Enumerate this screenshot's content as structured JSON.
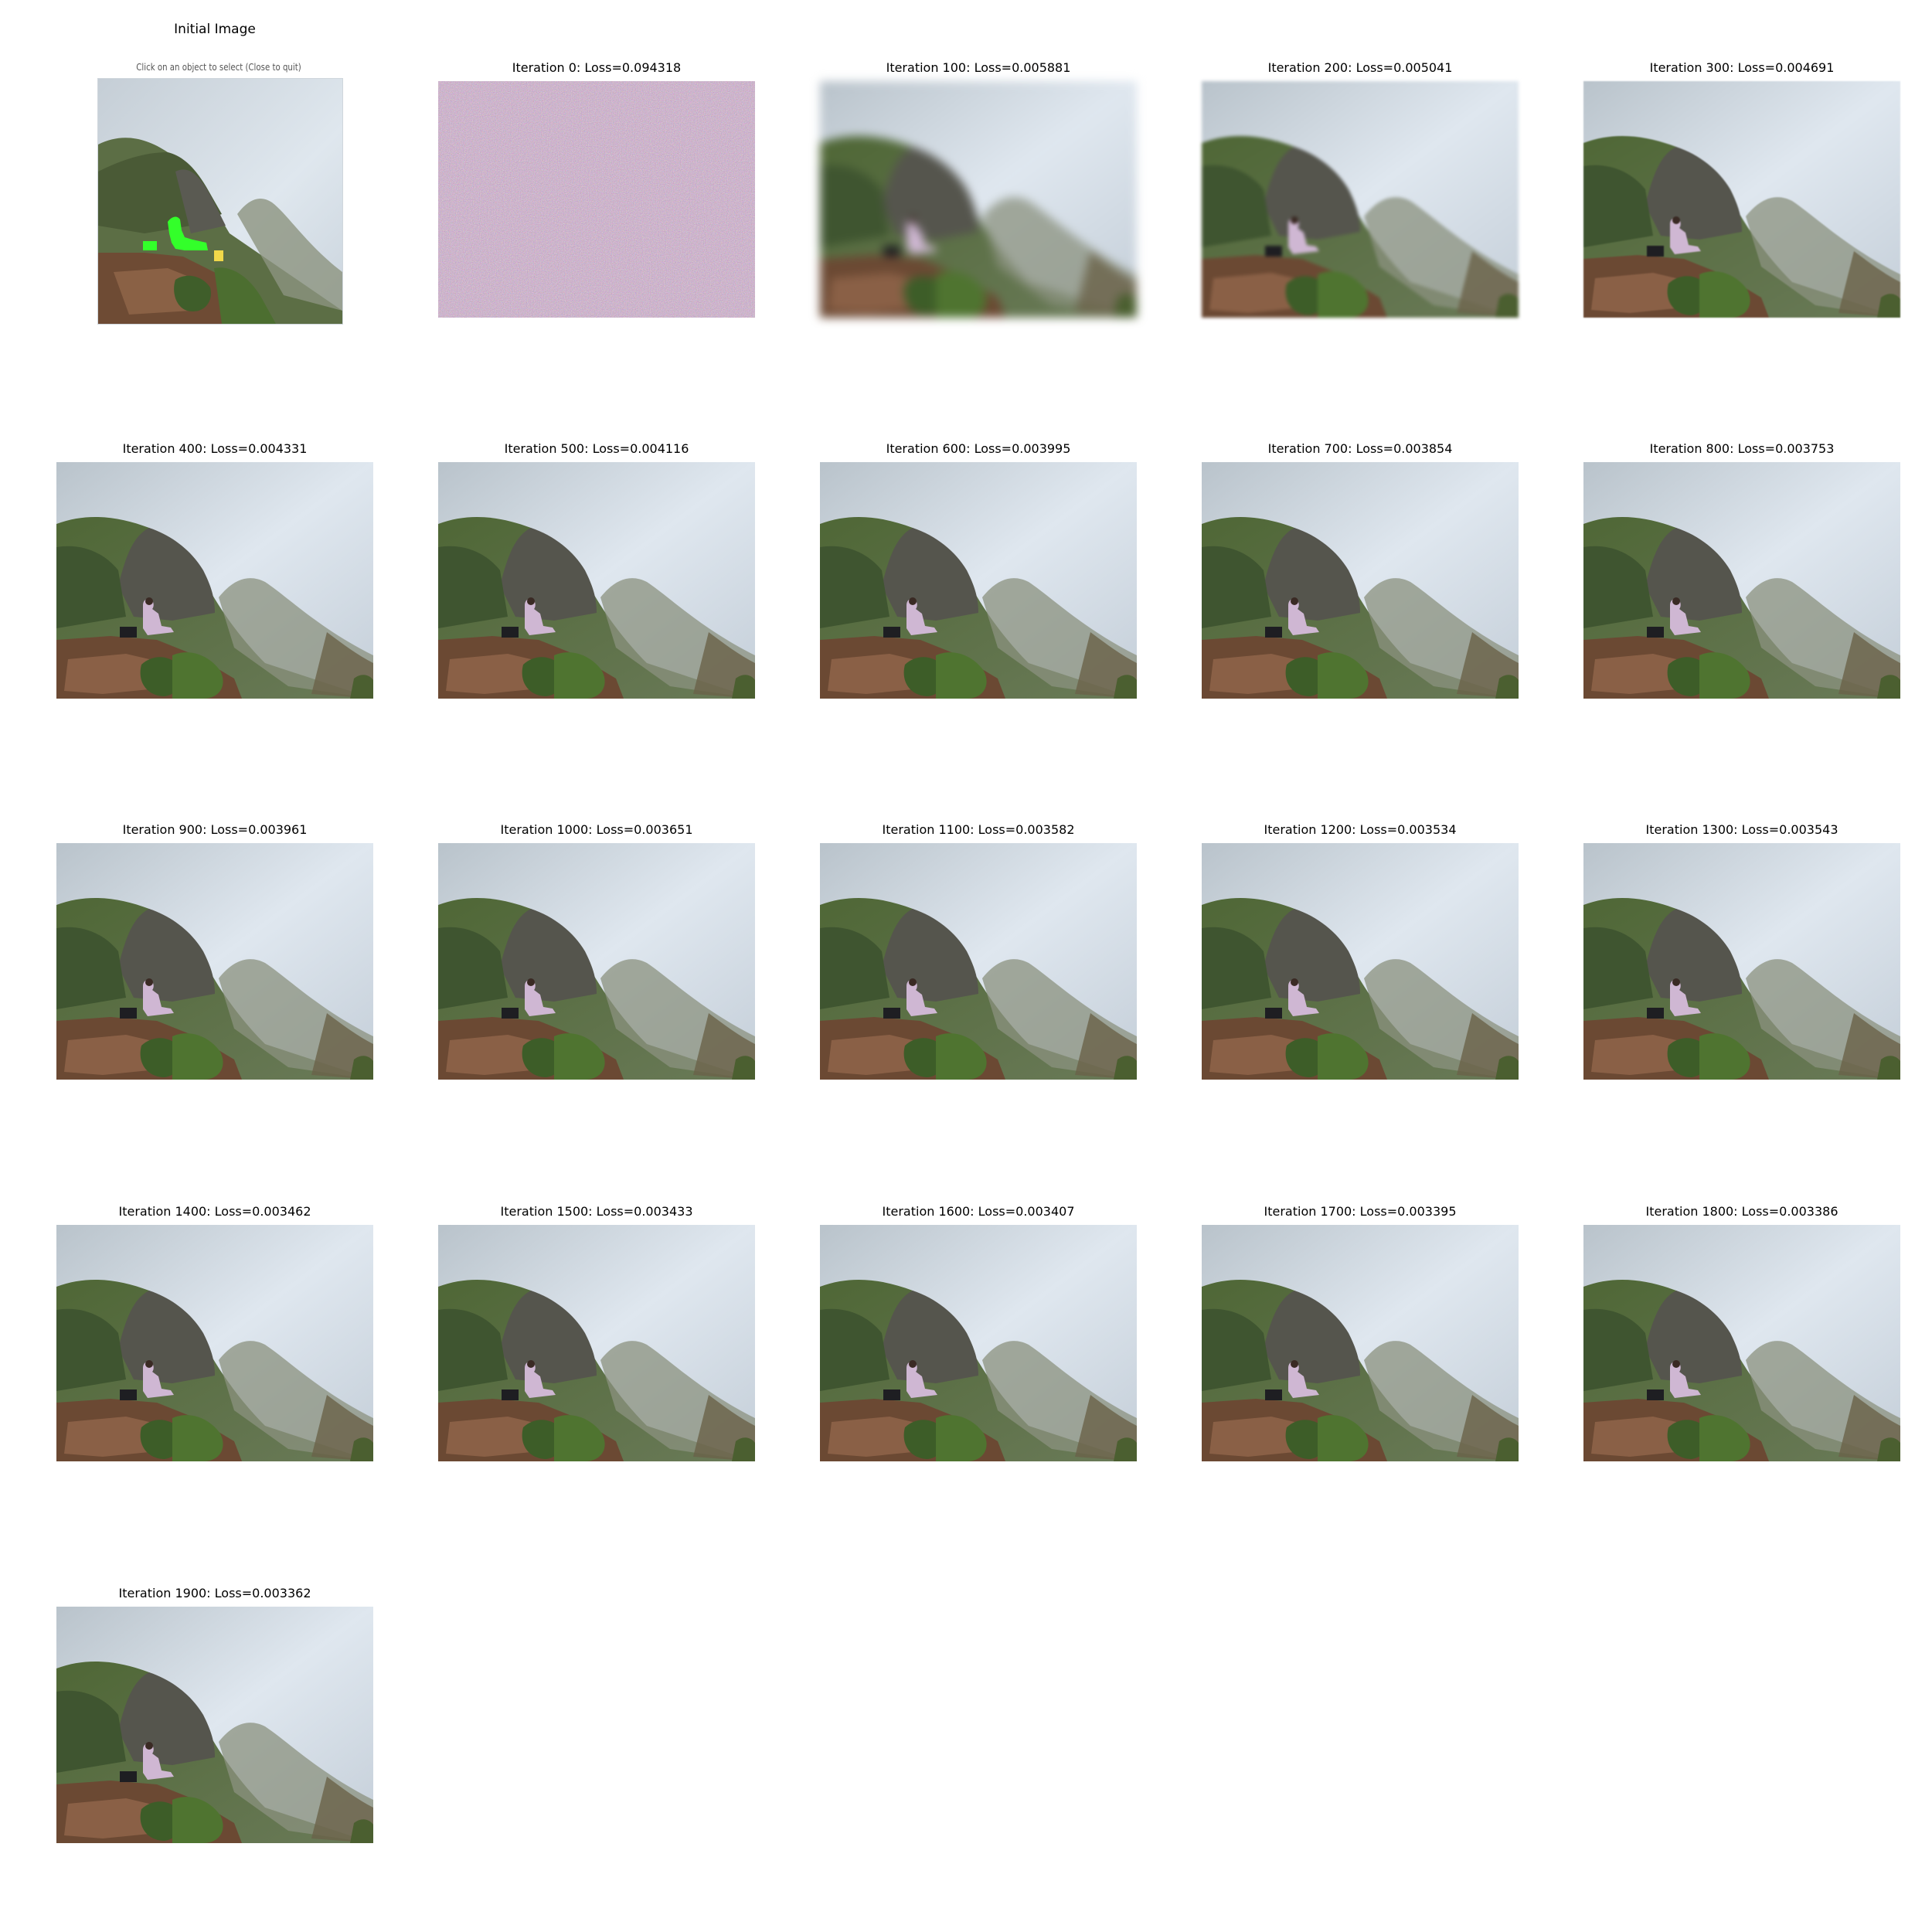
{
  "figure": {
    "initial_panel": {
      "title": "Initial Image",
      "caption": "Click on an object to select (Close to quit)",
      "selection_color": "#33ff2a"
    },
    "iterations": [
      {
        "title": "Iteration 0: Loss=0.094318",
        "iteration": 0,
        "loss": 0.094318,
        "render": "noise"
      },
      {
        "title": "Iteration 100: Loss=0.005881",
        "iteration": 100,
        "loss": 0.005881,
        "render": "heavy"
      },
      {
        "title": "Iteration 200: Loss=0.005041",
        "iteration": 200,
        "loss": 0.005041,
        "render": "medium"
      },
      {
        "title": "Iteration 300: Loss=0.004691",
        "iteration": 300,
        "loss": 0.004691,
        "render": "light"
      },
      {
        "title": "Iteration 400: Loss=0.004331",
        "iteration": 400,
        "loss": 0.004331,
        "render": "sharp"
      },
      {
        "title": "Iteration 500: Loss=0.004116",
        "iteration": 500,
        "loss": 0.004116,
        "render": "sharp"
      },
      {
        "title": "Iteration 600: Loss=0.003995",
        "iteration": 600,
        "loss": 0.003995,
        "render": "sharp"
      },
      {
        "title": "Iteration 700: Loss=0.003854",
        "iteration": 700,
        "loss": 0.003854,
        "render": "sharp"
      },
      {
        "title": "Iteration 800: Loss=0.003753",
        "iteration": 800,
        "loss": 0.003753,
        "render": "sharp"
      },
      {
        "title": "Iteration 900: Loss=0.003961",
        "iteration": 900,
        "loss": 0.003961,
        "render": "sharp"
      },
      {
        "title": "Iteration 1000: Loss=0.003651",
        "iteration": 1000,
        "loss": 0.003651,
        "render": "sharp"
      },
      {
        "title": "Iteration 1100: Loss=0.003582",
        "iteration": 1100,
        "loss": 0.003582,
        "render": "sharp"
      },
      {
        "title": "Iteration 1200: Loss=0.003534",
        "iteration": 1200,
        "loss": 0.003534,
        "render": "sharp"
      },
      {
        "title": "Iteration 1300: Loss=0.003543",
        "iteration": 1300,
        "loss": 0.003543,
        "render": "sharp"
      },
      {
        "title": "Iteration 1400: Loss=0.003462",
        "iteration": 1400,
        "loss": 0.003462,
        "render": "sharp"
      },
      {
        "title": "Iteration 1500: Loss=0.003433",
        "iteration": 1500,
        "loss": 0.003433,
        "render": "sharp"
      },
      {
        "title": "Iteration 1600: Loss=0.003407",
        "iteration": 1600,
        "loss": 0.003407,
        "render": "sharp"
      },
      {
        "title": "Iteration 1700: Loss=0.003395",
        "iteration": 1700,
        "loss": 0.003395,
        "render": "sharp"
      },
      {
        "title": "Iteration 1800: Loss=0.003386",
        "iteration": 1800,
        "loss": 0.003386,
        "render": "sharp"
      },
      {
        "title": "Iteration 1900: Loss=0.003362",
        "iteration": 1900,
        "loss": 0.003362,
        "render": "sharp"
      }
    ]
  }
}
